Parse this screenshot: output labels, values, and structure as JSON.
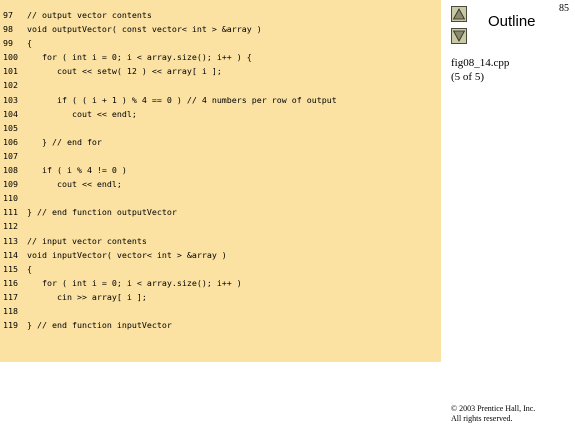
{
  "slide": {
    "page_number": "85",
    "outline_label": "Outline",
    "file_name": "fig08_14.cpp",
    "part": "(5 of 5)",
    "copyright_line1": "© 2003 Prentice Hall, Inc.",
    "copyright_line2": "All rights reserved."
  },
  "nav": {
    "up_icon": "up-triangle-icon",
    "down_icon": "down-triangle-icon"
  },
  "colors": {
    "code_background": "#fbe2a3",
    "nav_button": "#c9c9a6"
  },
  "code": [
    {
      "num": "97",
      "text": "// output vector contents"
    },
    {
      "num": "98",
      "text": "void outputVector( const vector< int > &array )"
    },
    {
      "num": "99",
      "text": "{"
    },
    {
      "num": "100",
      "text": "   for ( int i = 0; i < array.size(); i++ ) {"
    },
    {
      "num": "101",
      "text": "      cout << setw( 12 ) << array[ i ];"
    },
    {
      "num": "102",
      "text": ""
    },
    {
      "num": "103",
      "text": "      if ( ( i + 1 ) % 4 == 0 ) // 4 numbers per row of output"
    },
    {
      "num": "104",
      "text": "         cout << endl;"
    },
    {
      "num": "105",
      "text": ""
    },
    {
      "num": "106",
      "text": "   } // end for"
    },
    {
      "num": "107",
      "text": ""
    },
    {
      "num": "108",
      "text": "   if ( i % 4 != 0 )"
    },
    {
      "num": "109",
      "text": "      cout << endl;"
    },
    {
      "num": "110",
      "text": ""
    },
    {
      "num": "111",
      "text": "} // end function outputVector"
    },
    {
      "num": "112",
      "text": ""
    },
    {
      "num": "113",
      "text": "// input vector contents"
    },
    {
      "num": "114",
      "text": "void inputVector( vector< int > &array )"
    },
    {
      "num": "115",
      "text": "{"
    },
    {
      "num": "116",
      "text": "   for ( int i = 0; i < array.size(); i++ )"
    },
    {
      "num": "117",
      "text": "      cin >> array[ i ];"
    },
    {
      "num": "118",
      "text": ""
    },
    {
      "num": "119",
      "text": "} // end function inputVector"
    }
  ]
}
